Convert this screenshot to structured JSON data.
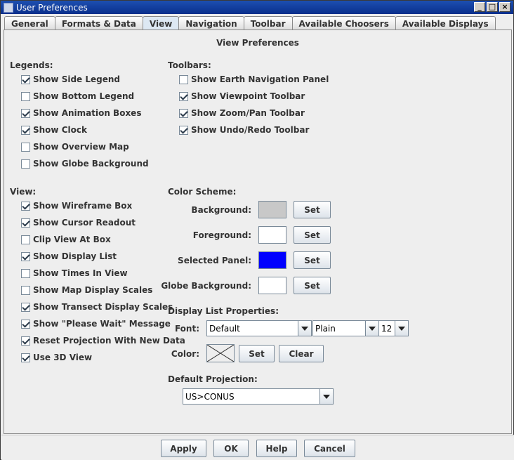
{
  "window": {
    "title": "User Preferences"
  },
  "tabs": [
    {
      "label": "General"
    },
    {
      "label": "Formats & Data"
    },
    {
      "label": "View"
    },
    {
      "label": "Navigation"
    },
    {
      "label": "Toolbar"
    },
    {
      "label": "Available Choosers"
    },
    {
      "label": "Available Displays"
    }
  ],
  "panel": {
    "title": "View Preferences"
  },
  "legends": {
    "heading": "Legends:",
    "items": [
      {
        "label": "Show Side Legend",
        "checked": true
      },
      {
        "label": "Show Bottom Legend",
        "checked": false
      },
      {
        "label": "Show Animation Boxes",
        "checked": true
      },
      {
        "label": "Show Clock",
        "checked": true
      },
      {
        "label": "Show Overview Map",
        "checked": false
      },
      {
        "label": "Show Globe Background",
        "checked": false
      }
    ]
  },
  "toolbars": {
    "heading": "Toolbars:",
    "items": [
      {
        "label": "Show Earth Navigation Panel",
        "checked": false
      },
      {
        "label": "Show Viewpoint Toolbar",
        "checked": true
      },
      {
        "label": "Show Zoom/Pan Toolbar",
        "checked": true
      },
      {
        "label": "Show Undo/Redo Toolbar",
        "checked": true
      }
    ]
  },
  "view": {
    "heading": "View:",
    "items": [
      {
        "label": "Show Wireframe Box",
        "checked": true
      },
      {
        "label": "Show Cursor Readout",
        "checked": true
      },
      {
        "label": "Clip View At Box",
        "checked": false
      },
      {
        "label": "Show Display List",
        "checked": true
      },
      {
        "label": "Show Times In View",
        "checked": false
      },
      {
        "label": "Show Map Display Scales",
        "checked": false
      },
      {
        "label": "Show Transect Display Scales",
        "checked": true
      },
      {
        "label": "Show \"Please Wait\" Message",
        "checked": true
      },
      {
        "label": "Reset Projection With New Data",
        "checked": true
      },
      {
        "label": "Use 3D View",
        "checked": true
      }
    ]
  },
  "color_scheme": {
    "heading": "Color Scheme:",
    "set_label": "Set",
    "rows": [
      {
        "label": "Background:",
        "color": "#c8c8c8"
      },
      {
        "label": "Foreground:",
        "color": "#ffffff"
      },
      {
        "label": "Selected Panel:",
        "color": "#0000ff"
      },
      {
        "label": "Globe Background:",
        "color": "#ffffff"
      }
    ]
  },
  "display_list": {
    "heading": "Display List Properties:",
    "font_label": "Font:",
    "font_family": "Default",
    "font_style": "Plain",
    "font_size": "12",
    "color_label": "Color:",
    "set_label": "Set",
    "clear_label": "Clear"
  },
  "projection": {
    "heading": "Default Projection:",
    "value": "US>CONUS"
  },
  "buttons": {
    "apply": "Apply",
    "ok": "OK",
    "help": "Help",
    "cancel": "Cancel"
  }
}
